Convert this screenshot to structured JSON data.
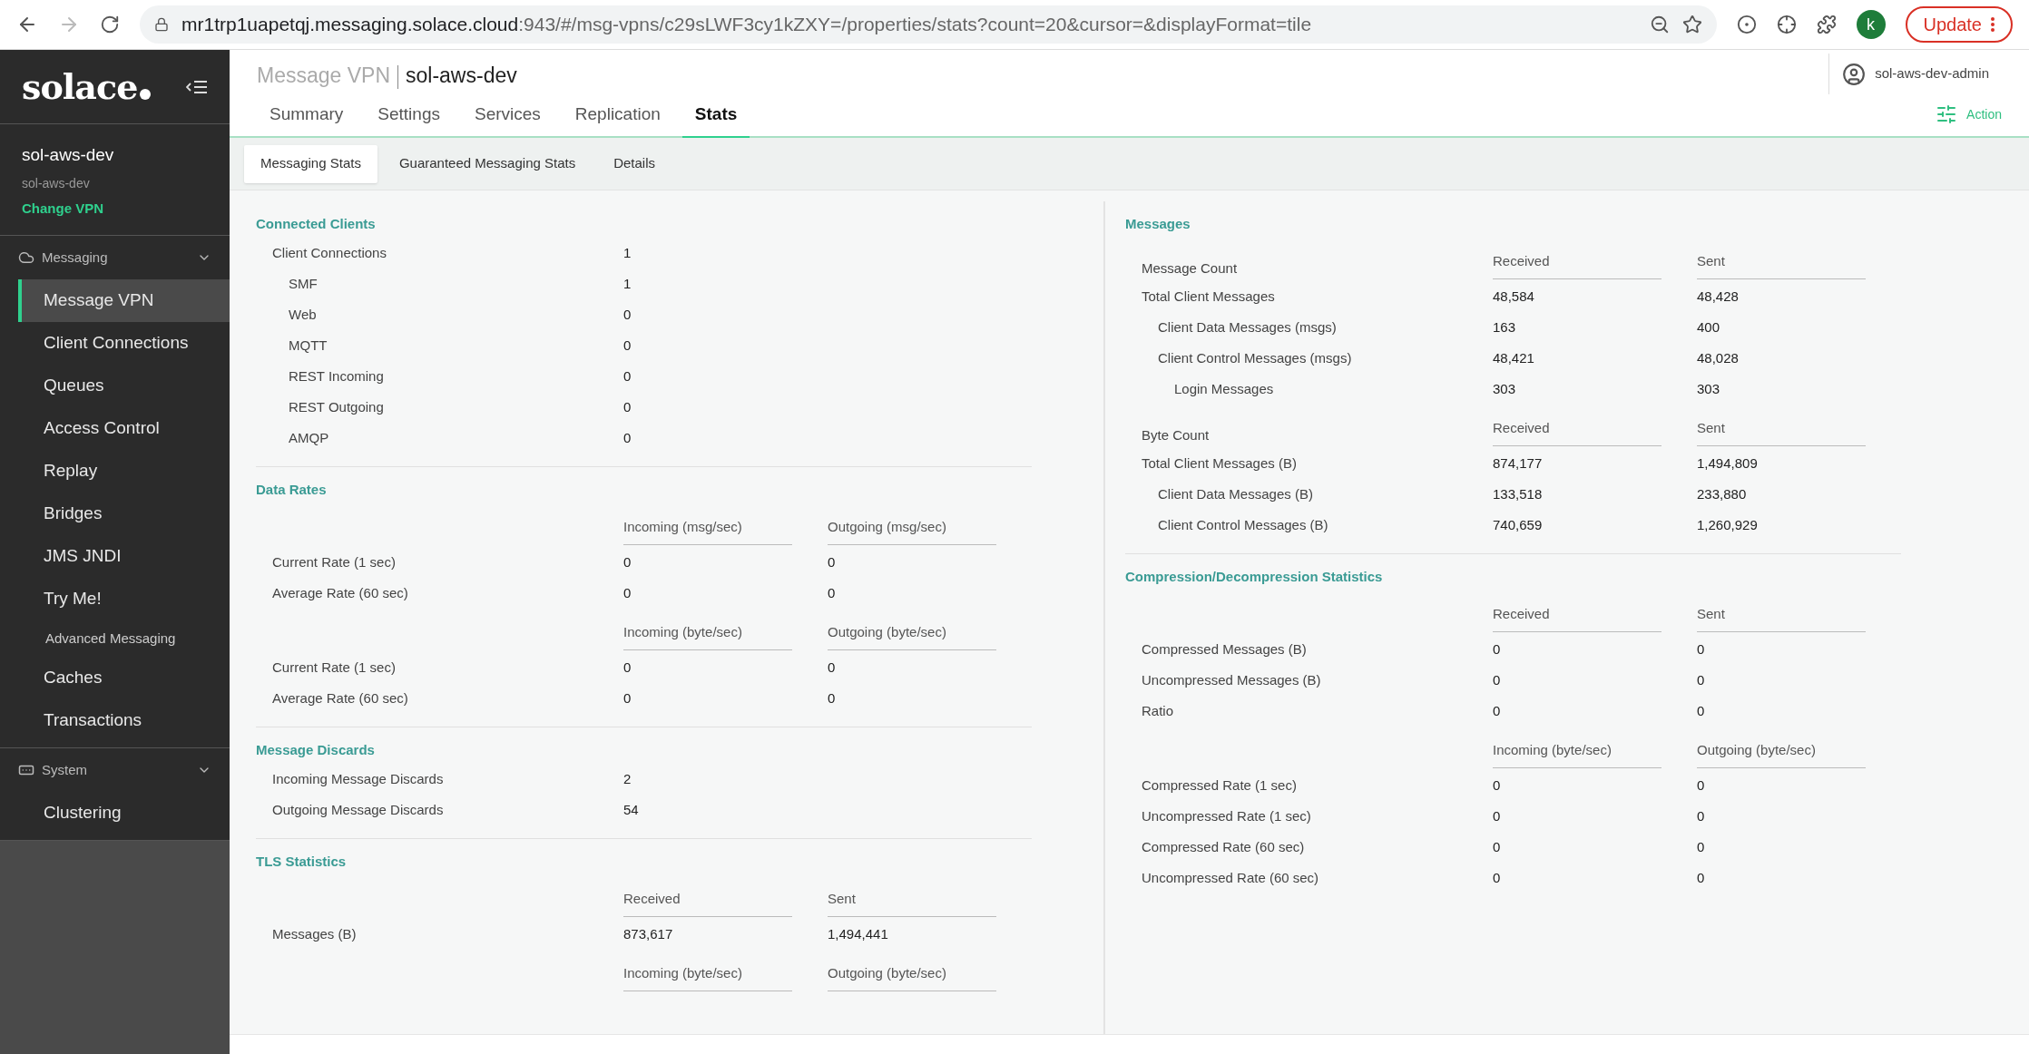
{
  "browser": {
    "url_host": "mr1trp1uapetqj.messaging.solace.cloud",
    "url_rest": ":943/#/msg-vpns/c29sLWF3cy1kZXY=/properties/stats?count=20&cursor=&displayFormat=tile",
    "profile_initial": "k",
    "update_label": "Update"
  },
  "sidebar": {
    "logo": "solace",
    "vpn_name": "sol-aws-dev",
    "vpn_sub": "sol-aws-dev",
    "change_vpn": "Change VPN",
    "groups": [
      {
        "label": "Messaging",
        "kind": "cloud",
        "expanded": true,
        "items": [
          {
            "label": "Message VPN",
            "kind": "item",
            "selected": true
          },
          {
            "label": "Client Connections",
            "kind": "item",
            "selected": false
          },
          {
            "label": "Queues",
            "kind": "item",
            "selected": false
          },
          {
            "label": "Access Control",
            "kind": "item",
            "selected": false
          },
          {
            "label": "Replay",
            "kind": "item",
            "selected": false
          },
          {
            "label": "Bridges",
            "kind": "item",
            "selected": false
          },
          {
            "label": "JMS JNDI",
            "kind": "item",
            "selected": false
          },
          {
            "label": "Try Me!",
            "kind": "item",
            "selected": false
          },
          {
            "label": "Advanced Messaging",
            "kind": "subheading"
          },
          {
            "label": "Caches",
            "kind": "item",
            "selected": false
          },
          {
            "label": "Transactions",
            "kind": "item",
            "selected": false
          }
        ]
      },
      {
        "label": "System",
        "kind": "system",
        "expanded": true,
        "items": [
          {
            "label": "Clustering",
            "kind": "item",
            "selected": false
          }
        ]
      }
    ]
  },
  "header": {
    "parent": "Message VPN",
    "title": "sol-aws-dev",
    "user": "sol-aws-dev-admin",
    "action": "Action"
  },
  "tabs": [
    {
      "label": "Summary",
      "selected": false
    },
    {
      "label": "Settings",
      "selected": false
    },
    {
      "label": "Services",
      "selected": false
    },
    {
      "label": "Replication",
      "selected": false
    },
    {
      "label": "Stats",
      "selected": true
    }
  ],
  "subtabs": [
    {
      "label": "Messaging Stats",
      "selected": true
    },
    {
      "label": "Guaranteed Messaging Stats",
      "selected": false
    },
    {
      "label": "Details",
      "selected": false
    }
  ],
  "left_sections": [
    {
      "title": "Connected Clients",
      "rows": [
        {
          "kind": "row",
          "label": "Client Connections",
          "values": [
            "1"
          ],
          "children": [
            {
              "kind": "row",
              "label": "SMF",
              "values": [
                "1"
              ]
            },
            {
              "kind": "row",
              "label": "Web",
              "values": [
                "0"
              ]
            },
            {
              "kind": "row",
              "label": "MQTT",
              "values": [
                "0"
              ]
            },
            {
              "kind": "row",
              "label": "REST Incoming",
              "values": [
                "0"
              ]
            },
            {
              "kind": "row",
              "label": "REST Outgoing",
              "values": [
                "0"
              ]
            },
            {
              "kind": "row",
              "label": "AMQP",
              "values": [
                "0"
              ]
            }
          ]
        }
      ]
    },
    {
      "title": "Data Rates",
      "rows": [
        {
          "kind": "header",
          "values": [
            "Incoming (msg/sec)",
            "Outgoing (msg/sec)"
          ]
        },
        {
          "kind": "row",
          "label": "Current Rate (1 sec)",
          "values": [
            "0",
            "0"
          ]
        },
        {
          "kind": "row",
          "label": "Average Rate (60 sec)",
          "values": [
            "0",
            "0"
          ]
        },
        {
          "kind": "header",
          "values": [
            "Incoming (byte/sec)",
            "Outgoing (byte/sec)"
          ]
        },
        {
          "kind": "row",
          "label": "Current Rate (1 sec)",
          "values": [
            "0",
            "0"
          ]
        },
        {
          "kind": "row",
          "label": "Average Rate (60 sec)",
          "values": [
            "0",
            "0"
          ]
        }
      ]
    },
    {
      "title": "Message Discards",
      "rows": [
        {
          "kind": "row",
          "label": "Incoming Message Discards",
          "values": [
            "2"
          ]
        },
        {
          "kind": "row",
          "label": "Outgoing Message Discards",
          "values": [
            "54"
          ]
        }
      ]
    },
    {
      "title": "TLS Statistics",
      "rows": [
        {
          "kind": "header",
          "values": [
            "Received",
            "Sent"
          ]
        },
        {
          "kind": "row",
          "label": "Messages (B)",
          "values": [
            "873,617",
            "1,494,441"
          ]
        },
        {
          "kind": "header",
          "values": [
            "Incoming (byte/sec)",
            "Outgoing (byte/sec)"
          ]
        }
      ]
    }
  ],
  "right_sections": [
    {
      "title": "Messages",
      "rows": [
        {
          "kind": "header",
          "label": "Message Count",
          "values": [
            "Received",
            "Sent"
          ]
        },
        {
          "kind": "row",
          "label": "Total Client Messages",
          "values": [
            "48,584",
            "48,428"
          ],
          "children": [
            {
              "kind": "row",
              "label": "Client Data Messages (msgs)",
              "values": [
                "163",
                "400"
              ]
            },
            {
              "kind": "row",
              "label": "Client Control Messages (msgs)",
              "values": [
                "48,421",
                "48,028"
              ],
              "children": [
                {
                  "kind": "row",
                  "label": "Login Messages",
                  "values": [
                    "303",
                    "303"
                  ]
                }
              ]
            }
          ]
        },
        {
          "kind": "header",
          "label": "Byte Count",
          "values": [
            "Received",
            "Sent"
          ]
        },
        {
          "kind": "row",
          "label": "Total Client Messages (B)",
          "values": [
            "874,177",
            "1,494,809"
          ],
          "children": [
            {
              "kind": "row",
              "label": "Client Data Messages (B)",
              "values": [
                "133,518",
                "233,880"
              ]
            },
            {
              "kind": "row",
              "label": "Client Control Messages (B)",
              "values": [
                "740,659",
                "1,260,929"
              ]
            }
          ]
        }
      ]
    },
    {
      "title": "Compression/Decompression Statistics",
      "rows": [
        {
          "kind": "header",
          "values": [
            "Received",
            "Sent"
          ]
        },
        {
          "kind": "row",
          "label": "Compressed Messages (B)",
          "values": [
            "0",
            "0"
          ]
        },
        {
          "kind": "row",
          "label": "Uncompressed Messages (B)",
          "values": [
            "0",
            "0"
          ]
        },
        {
          "kind": "row",
          "label": "Ratio",
          "values": [
            "0",
            "0"
          ]
        },
        {
          "kind": "header",
          "values": [
            "Incoming (byte/sec)",
            "Outgoing (byte/sec)"
          ]
        },
        {
          "kind": "row",
          "label": "Compressed Rate (1 sec)",
          "values": [
            "0",
            "0"
          ]
        },
        {
          "kind": "row",
          "label": "Uncompressed Rate (1 sec)",
          "values": [
            "0",
            "0"
          ]
        },
        {
          "kind": "row",
          "label": "Compressed Rate (60 sec)",
          "values": [
            "0",
            "0"
          ]
        },
        {
          "kind": "row",
          "label": "Uncompressed Rate (60 sec)",
          "values": [
            "0",
            "0"
          ]
        }
      ]
    }
  ]
}
